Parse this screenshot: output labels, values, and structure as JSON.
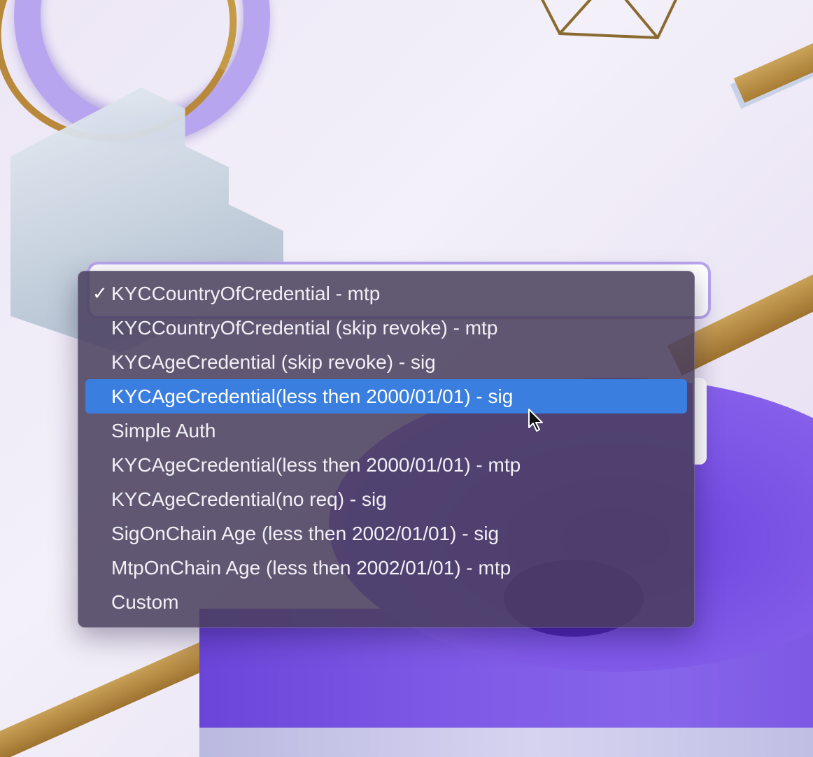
{
  "dropdown": {
    "selected_label": "KYCCountryOfCredential - mtp",
    "highlighted_label": "KYCAgeCredential(less then 2000/01/01) - sig",
    "check_glyph": "✓",
    "options": [
      {
        "label": "KYCCountryOfCredential - mtp"
      },
      {
        "label": "KYCCountryOfCredential (skip revoke) - mtp"
      },
      {
        "label": "KYCAgeCredential (skip revoke) - sig"
      },
      {
        "label": "KYCAgeCredential(less then 2000/01/01) - sig"
      },
      {
        "label": "Simple Auth"
      },
      {
        "label": "KYCAgeCredential(less then 2000/01/01) - mtp"
      },
      {
        "label": "KYCAgeCredential(no req) - sig"
      },
      {
        "label": "SigOnChain Age (less then 2002/01/01) - sig"
      },
      {
        "label": "MtpOnChain Age (less then 2002/01/01) - mtp"
      },
      {
        "label": "Custom"
      }
    ]
  },
  "colors": {
    "highlight": "#3a7ee0",
    "menu_background": "#483e5c",
    "accent_purple": "#7c55e6",
    "gold": "#b8893a"
  },
  "icons": {
    "cursor": "arrow-pointer-icon",
    "check": "checkmark-icon"
  }
}
